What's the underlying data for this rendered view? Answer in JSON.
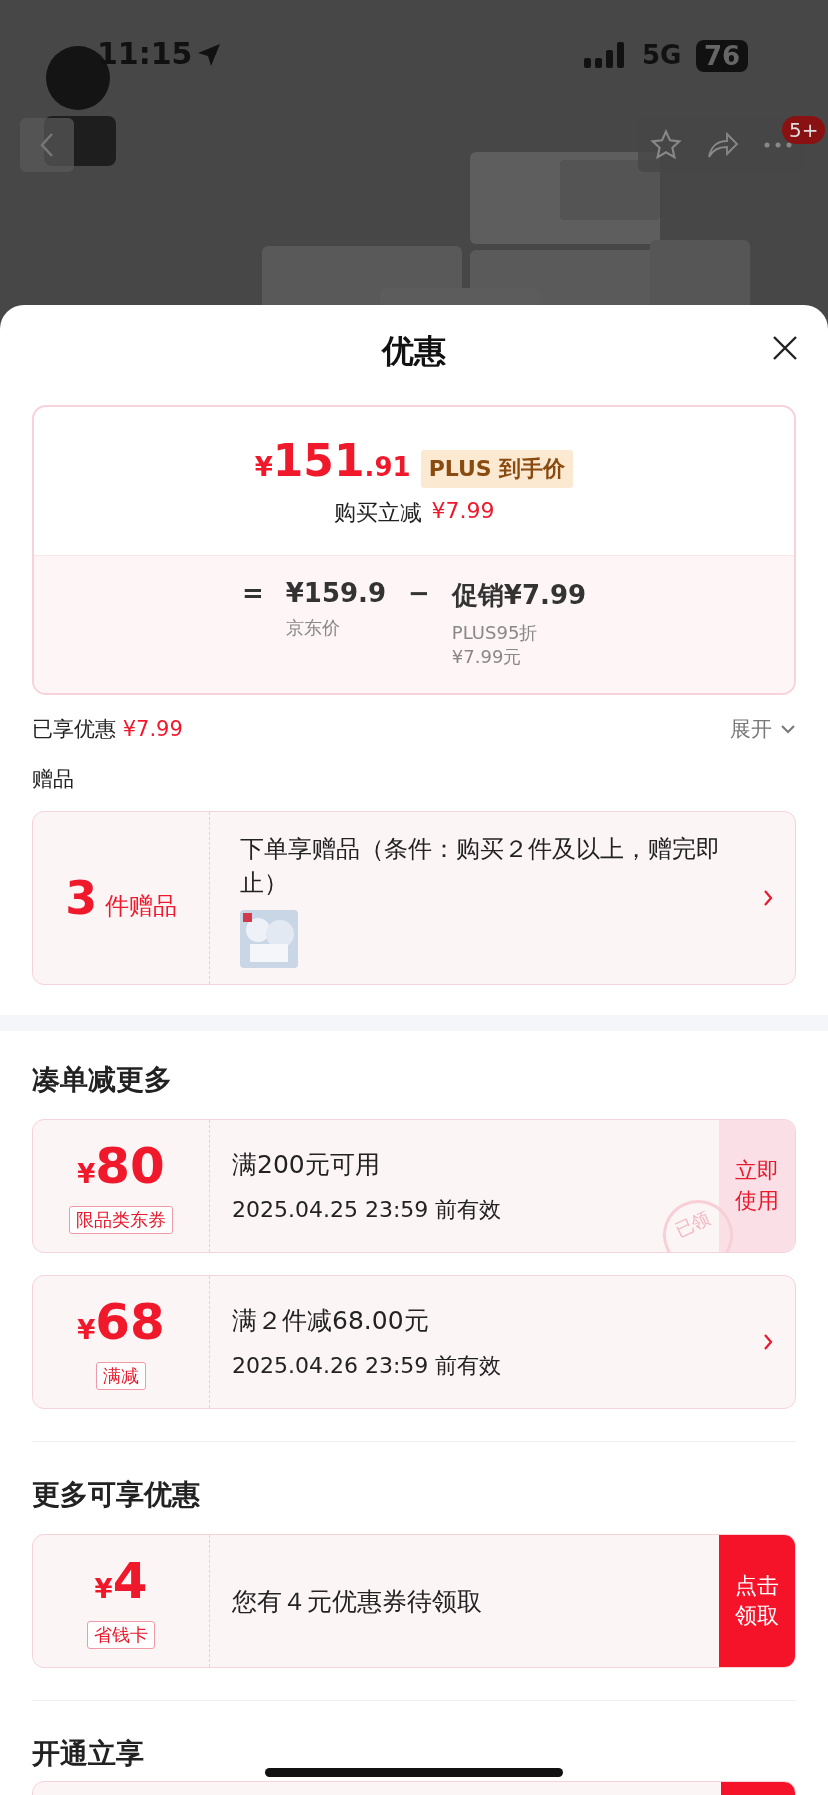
{
  "status_bar": {
    "time": "11:15",
    "network": "5G",
    "battery": "76"
  },
  "nav": {
    "badge": "5+"
  },
  "sheet": {
    "title": "优惠"
  },
  "price_card": {
    "currency": "¥",
    "integer": "151",
    "decimals": ".91",
    "tag": "PLUS 到手价",
    "instant_label": "购买立减",
    "instant_amount": "¥7.99",
    "formula": {
      "equals": "=",
      "base_price": "¥159.9",
      "base_label": "京东价",
      "minus": "−",
      "promo_label": "促销",
      "promo_amount": "¥7.99",
      "promo_notes": [
        "PLUS95折",
        "¥7.99元"
      ]
    }
  },
  "enjoyed": {
    "label": "已享优惠",
    "amount": "¥7.99",
    "expand": "展开",
    "expanded": false
  },
  "gifts": {
    "heading": "赠品",
    "count": "3",
    "unit": "件赠品",
    "text": "下单享赠品（条件：购买２件及以上，赠完即止）"
  },
  "sections": [
    {
      "title": "凑单减更多",
      "coupons": [
        {
          "currency": "¥",
          "amount": "80",
          "tag": "限品类东券",
          "title": "满200元可用",
          "validity": "2025.04.25 23:59 前有效",
          "stamp": "已领",
          "action": {
            "kind": "use",
            "label": "立即使用"
          }
        },
        {
          "currency": "¥",
          "amount": "68",
          "tag": "满减",
          "title": "满２件减68.00元",
          "validity": "2025.04.26 23:59 前有效",
          "action": {
            "kind": "chevron"
          }
        }
      ]
    },
    {
      "title": "更多可享优惠",
      "coupons": [
        {
          "currency": "¥",
          "amount": "4",
          "tag": "省钱卡",
          "title": "您有４元优惠券待领取",
          "action": {
            "kind": "claim",
            "label": "点击领取"
          }
        }
      ]
    },
    {
      "title": "开通立享",
      "peek": true
    }
  ]
}
